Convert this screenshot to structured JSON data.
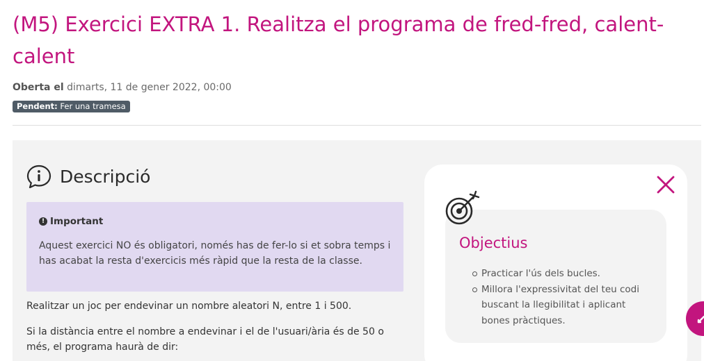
{
  "header": {
    "title": "(M5) Exercici EXTRA 1. Realitza el programa de fred-fred, calent-calent",
    "opened_label": "Oberta el",
    "opened_date": "dimarts, 11 de gener 2022, 00:00",
    "status_label": "Pendent:",
    "status_value": "Fer una tramesa"
  },
  "description": {
    "title": "Descripció",
    "important_title": "Important",
    "important_text": "Aquest exercici NO és obligatori, només has de fer-lo si et sobra temps i has acabat la resta d'exercicis més ràpid que la resta de la classe.",
    "paragraphs": [
      "Realitzar un joc per endevinar un nombre aleatori N, entre 1 i 500.",
      "Si la distància entre el nombre a endevinar i el de l'usuari/ària és de 50 o més, el programa haurà de dir:"
    ]
  },
  "objectives": {
    "title": "Objectius",
    "items": [
      "Practicar l'ús dels bucles.",
      "Millora l'expressivitat del teu codi buscant la llegibilitat i aplicant bones pràctiques."
    ]
  },
  "colors": {
    "accent": "#c2157e",
    "important_bg": "#e1d9f1",
    "content_bg": "#f3f3f3",
    "badge_bg": "#4f5b66"
  },
  "icons": {
    "info": "info-icon",
    "exclamation": "exclamation-icon",
    "close": "close-icon",
    "target": "target-icon",
    "fab": "expand-icon"
  }
}
